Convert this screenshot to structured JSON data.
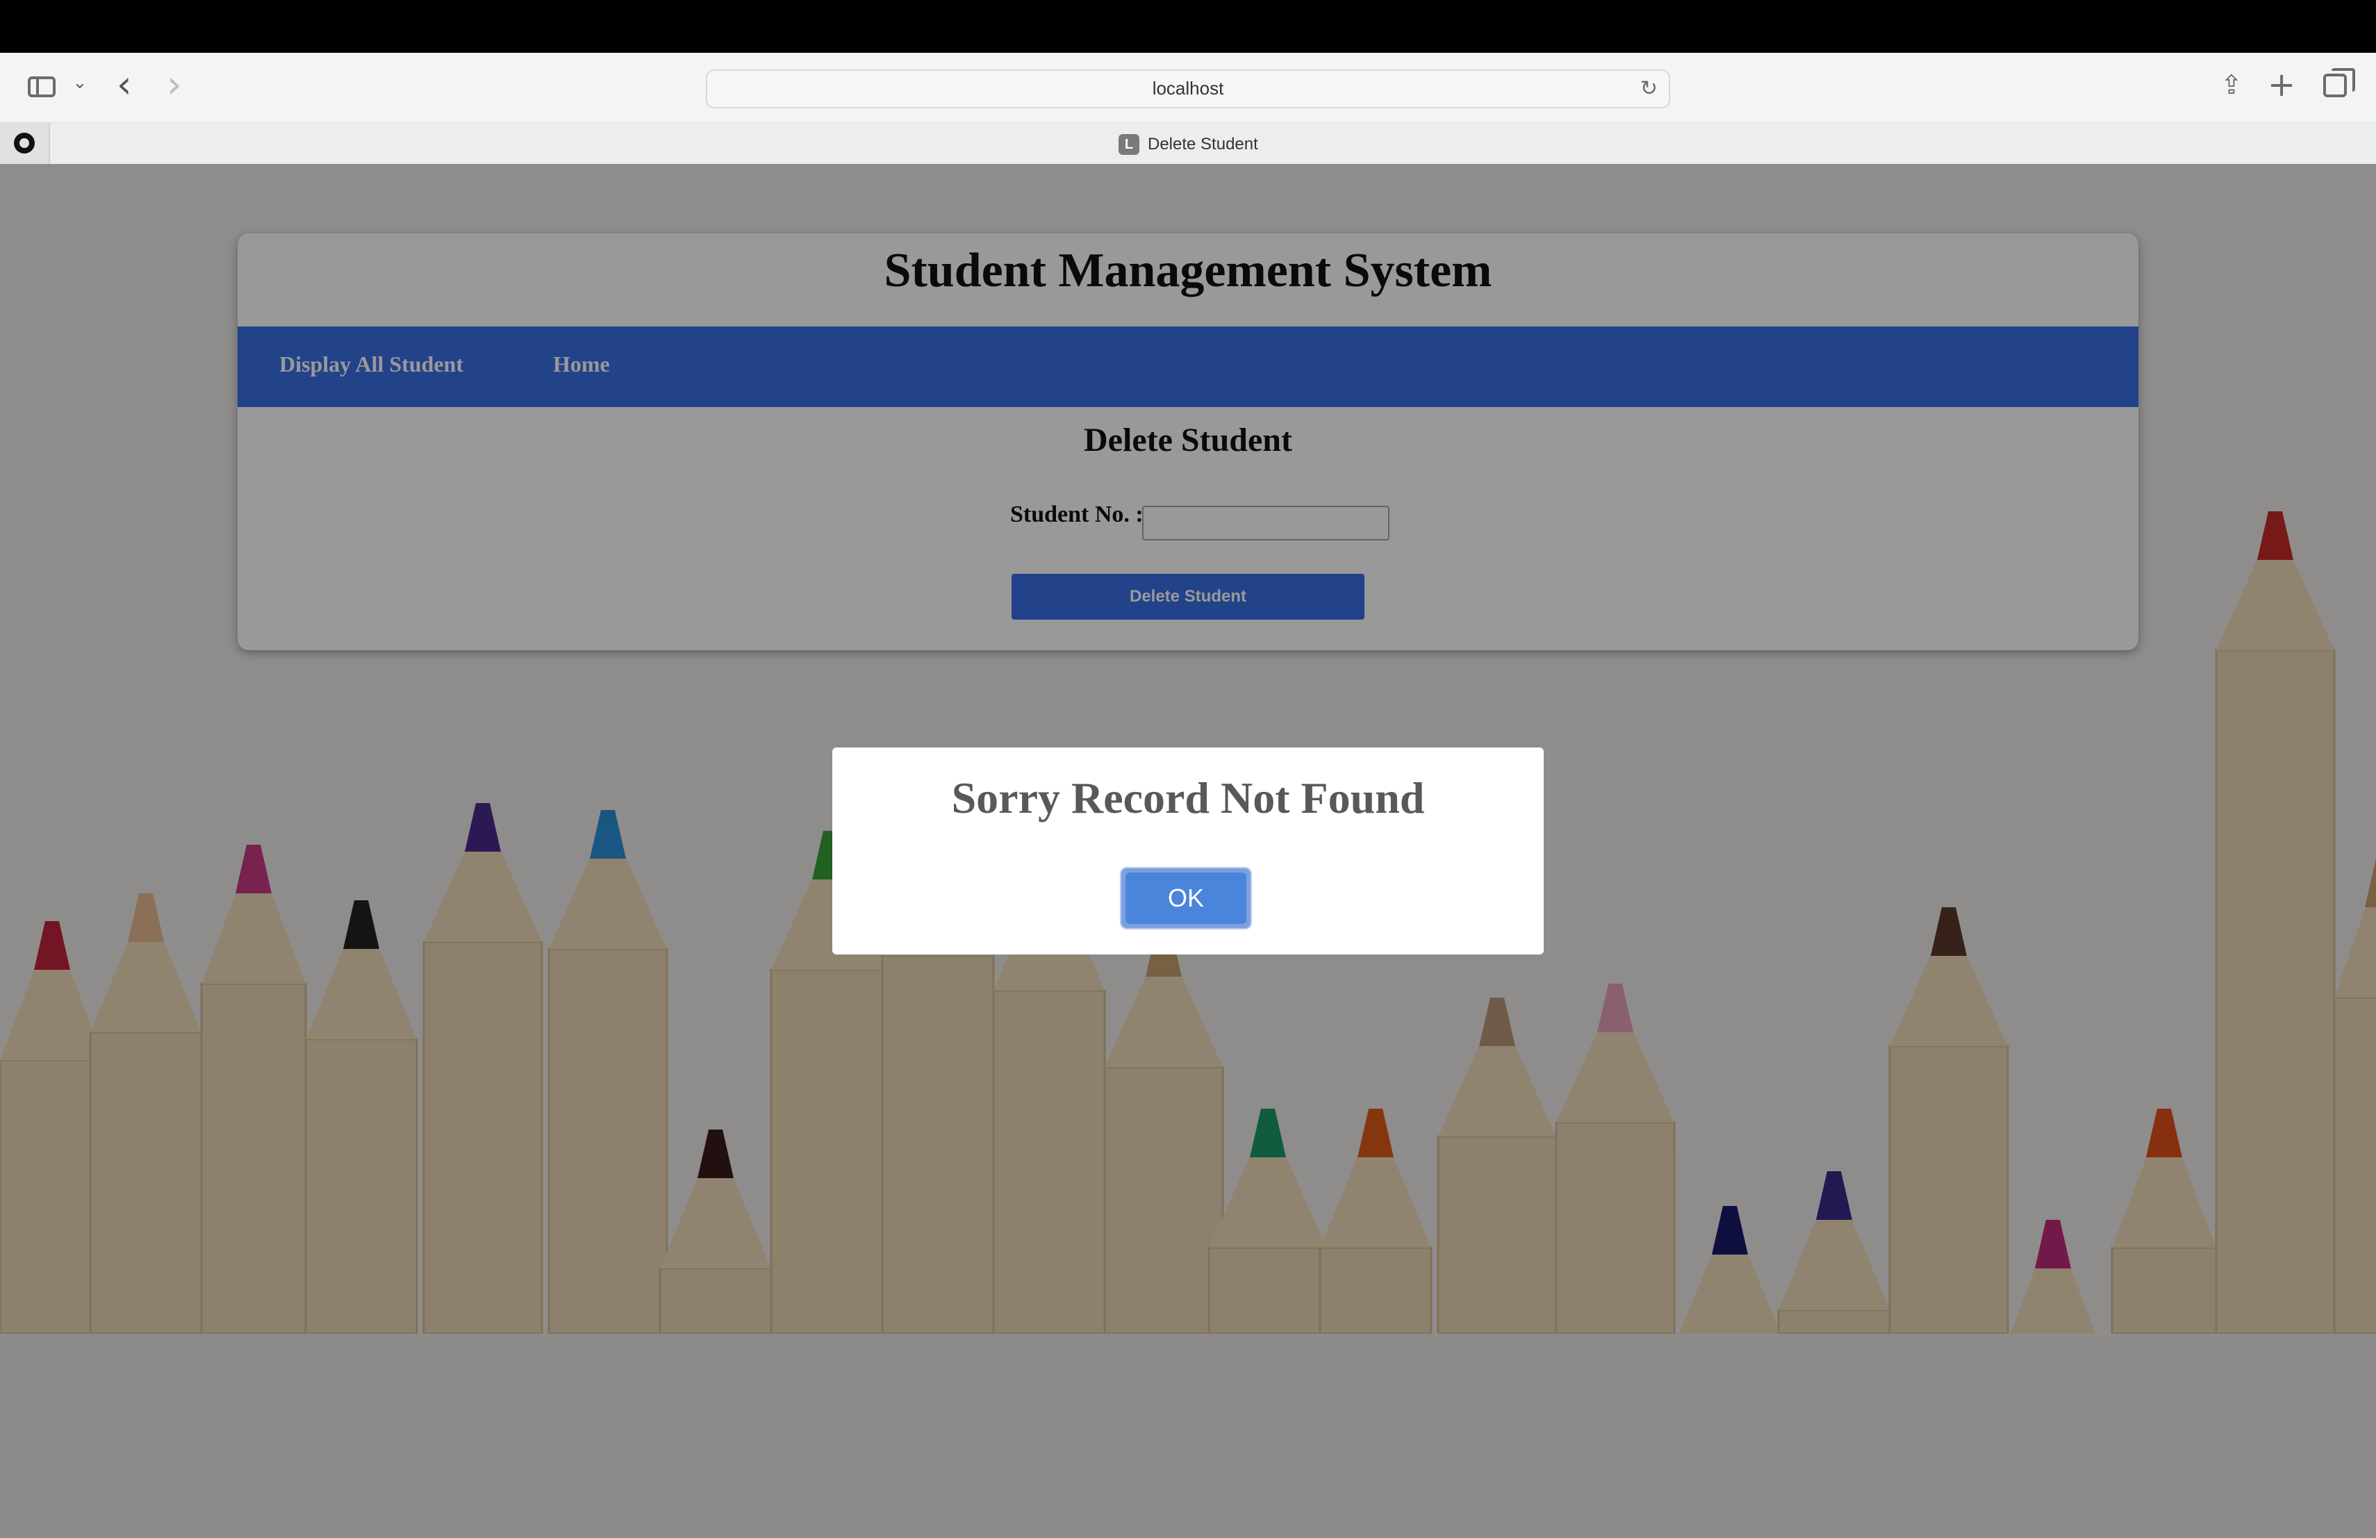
{
  "browser": {
    "address": "localhost",
    "tab_title": "Delete Student",
    "tab_favicon_letter": "L",
    "icons": [
      "sidebar-icon",
      "chevron-down-icon",
      "back-icon",
      "forward-icon",
      "reload-icon",
      "share-icon",
      "plus-icon",
      "tabs-icon",
      "github-icon"
    ]
  },
  "header": {
    "title": "Student Management System"
  },
  "nav": {
    "items": [
      "Display All Student",
      "Home"
    ]
  },
  "form": {
    "title": "Delete Student",
    "student_no_label": "Student No. :",
    "student_no_value": "",
    "submit_label": "Delete Student"
  },
  "dialog": {
    "message": "Sorry Record Not Found",
    "ok_label": "OK"
  },
  "colors": {
    "nav_bar": "#3a6fe6",
    "button": "#3a6fe6",
    "ok_button": "#4b84db"
  }
}
